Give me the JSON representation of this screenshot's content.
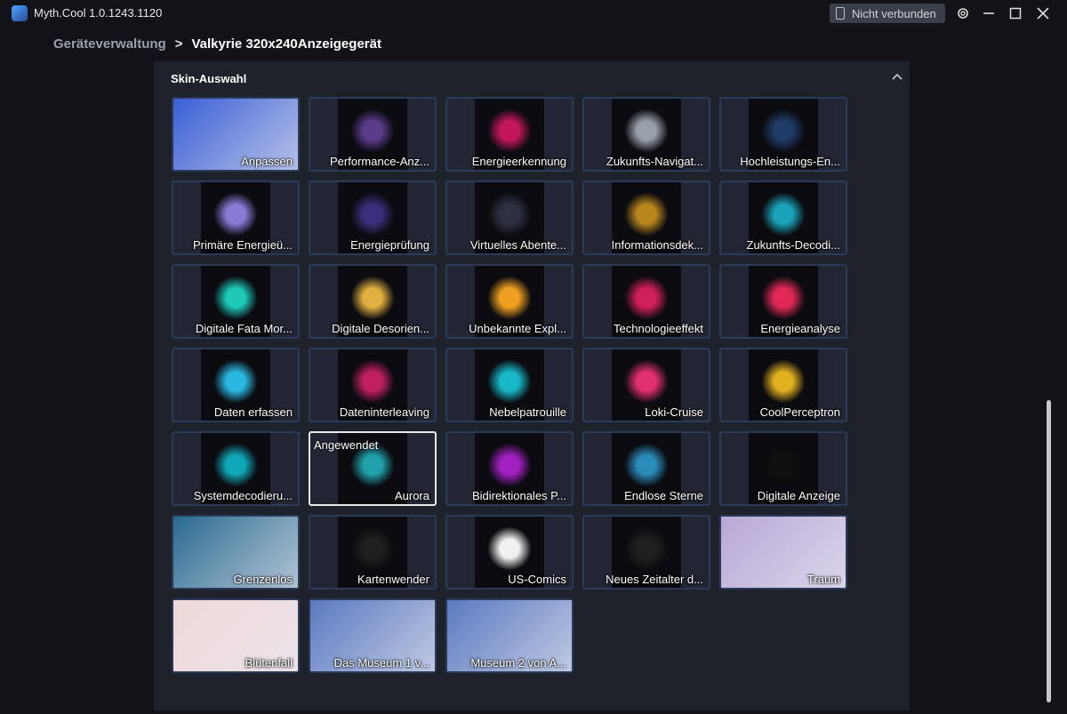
{
  "app": {
    "title": "Myth.Cool 1.0.1243.1120",
    "connection": "Nicht verbunden"
  },
  "breadcrumb": {
    "parent": "Geräteverwaltung",
    "separator": ">",
    "current": "Valkyrie 320x240Anzeigegerät"
  },
  "panel": {
    "title": "Skin-Auswahl",
    "applied_label": "Angewendet"
  },
  "skins": [
    {
      "label": "Anpassen",
      "color": "#3a5fd6",
      "wide": true
    },
    {
      "label": "Performance-Anz...",
      "color": "#5a3c8a"
    },
    {
      "label": "Energieerkennung",
      "color": "#c2185b"
    },
    {
      "label": "Zukunfts-Navigat...",
      "color": "#9aa0aa"
    },
    {
      "label": "Hochleistungs-En...",
      "color": "#1f3b66"
    },
    {
      "label": "Primäre Energieü...",
      "color": "#8a7ad6"
    },
    {
      "label": "Energieprüfung",
      "color": "#3a2f7a"
    },
    {
      "label": "Virtuelles Abente...",
      "color": "#2e3140"
    },
    {
      "label": "Informationsdek...",
      "color": "#b8861e"
    },
    {
      "label": "Zukunfts-Decodi...",
      "color": "#1aa3b8"
    },
    {
      "label": "Digitale Fata Mor...",
      "color": "#1ec9b8"
    },
    {
      "label": "Digitale Desorien...",
      "color": "#e0b040"
    },
    {
      "label": "Unbekannte Expl...",
      "color": "#f0a020"
    },
    {
      "label": "Technologieeffekt",
      "color": "#d0205a"
    },
    {
      "label": "Energieanalyse",
      "color": "#e02858"
    },
    {
      "label": "Daten erfassen",
      "color": "#2ab8e0"
    },
    {
      "label": "Dateninterleaving",
      "color": "#c02060"
    },
    {
      "label": "Nebelpatrouille",
      "color": "#18b8c8"
    },
    {
      "label": "Loki-Cruise",
      "color": "#e03070"
    },
    {
      "label": "CoolPerceptron",
      "color": "#e0b020"
    },
    {
      "label": "Systemdecodieru...",
      "color": "#10a8b8"
    },
    {
      "label": "Aurora",
      "color": "#20a0a8",
      "applied": true
    },
    {
      "label": "Bidirektionales P...",
      "color": "#a020c0"
    },
    {
      "label": "Endlose Sterne",
      "color": "#2a8ab8"
    },
    {
      "label": "Digitale Anzeige",
      "color": "#101010"
    },
    {
      "label": "Grenzenlos",
      "color": "#2a6a90",
      "wide": true
    },
    {
      "label": "Kartenwender",
      "color": "#202020"
    },
    {
      "label": "US-Comics",
      "color": "#f0f0f0"
    },
    {
      "label": "Neues Zeitalter d...",
      "color": "#202020"
    },
    {
      "label": "Traum",
      "color": "#b8a8d8",
      "wide": true
    },
    {
      "label": "Blütenfall",
      "color": "#f0d8d8",
      "wide": true
    },
    {
      "label": "Das Museum 1 v...",
      "color": "#5a7ac0",
      "wide": true
    },
    {
      "label": "Museum 2 von A...",
      "color": "#5a7ac0",
      "wide": true
    }
  ]
}
